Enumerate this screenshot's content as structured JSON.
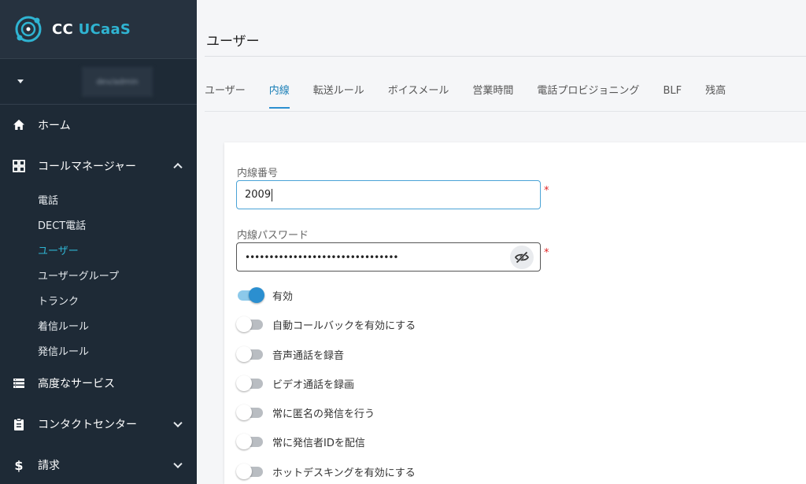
{
  "brand": {
    "prefix": "CC ",
    "accent": "UCaaS"
  },
  "account": {
    "name": "dev/admin"
  },
  "sidebar": {
    "home": "ホーム",
    "call_manager": "コールマネージャー",
    "sub_items": [
      "電話",
      "DECT電話",
      "ユーザー",
      "ユーザーグループ",
      "トランク",
      "着信ルール",
      "発信ルール"
    ],
    "active_sub": "ユーザー",
    "advanced": "高度なサービス",
    "contact_center": "コンタクトセンター",
    "billing": "請求"
  },
  "page": {
    "title": "ユーザー",
    "tabs": [
      "ユーザー",
      "内線",
      "転送ルール",
      "ボイスメール",
      "営業時間",
      "電話プロビジョニング",
      "BLF",
      "残高"
    ],
    "active_tab": "内線"
  },
  "form": {
    "ext_label": "内線番号",
    "ext_value": "2009",
    "pw_label": "内線パスワード",
    "pw_value": "••••••••••••••••••••••••••••••••",
    "required_mark": "*",
    "toggles": [
      {
        "label": "有効",
        "on": true
      },
      {
        "label": "自動コールバックを有効にする",
        "on": false
      },
      {
        "label": "音声通話を録音",
        "on": false
      },
      {
        "label": "ビデオ通話を録画",
        "on": false
      },
      {
        "label": "常に匿名の発信を行う",
        "on": false
      },
      {
        "label": "常に発信者IDを配信",
        "on": false
      },
      {
        "label": "ホットデスキングを有効にする",
        "on": false
      }
    ]
  },
  "colors": {
    "sidebar": "#1e2a36",
    "accent": "#2b8fd0",
    "brand_accent": "#2fb4d2",
    "required": "#e02424"
  },
  "icons": [
    "logo-icon",
    "caret-down-icon",
    "home-icon",
    "grid-icon",
    "chevron-up-icon",
    "list-icon",
    "clipboard-icon",
    "dollar-icon",
    "chevron-down-icon",
    "eye-off-icon"
  ]
}
